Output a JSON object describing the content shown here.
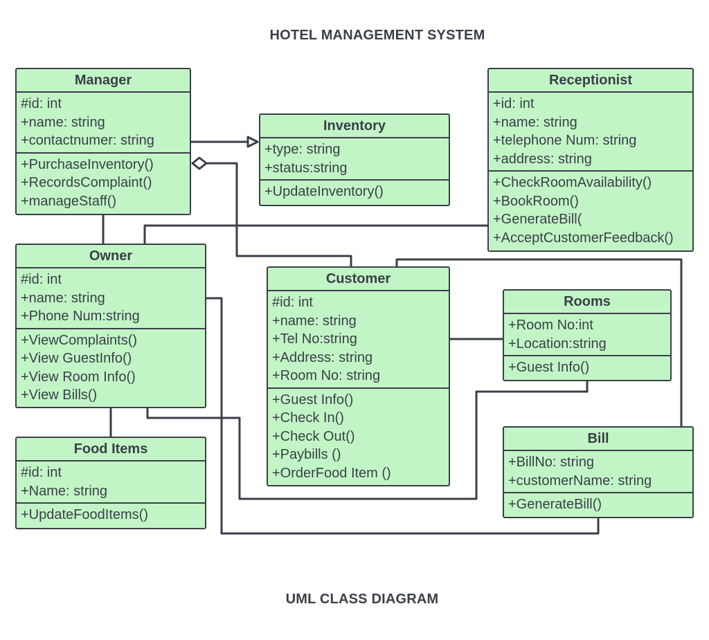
{
  "title": "HOTEL MANAGEMENT SYSTEM",
  "subtitle": "UML CLASS DIAGRAM",
  "colors": {
    "class_fill": "#c2f5c6",
    "stroke": "#3a3f47",
    "text": "#3a3f47"
  },
  "classes": {
    "manager": {
      "name": "Manager",
      "attributes": [
        "#id: int",
        "+name: string",
        "+contactnumer: string"
      ],
      "methods": [
        "+PurchaseInventory()",
        "+RecordsComplaint()",
        "+manageStaff()"
      ]
    },
    "inventory": {
      "name": "Inventory",
      "attributes": [
        "+type: string",
        "+status:string"
      ],
      "methods": [
        "+UpdateInventory()"
      ]
    },
    "receptionist": {
      "name": "Receptionist",
      "attributes": [
        "+id: int",
        "+name: string",
        "+telephone Num: string",
        "+address: string"
      ],
      "methods": [
        "+CheckRoomAvailability()",
        "+BookRoom()",
        "+GenerateBill(",
        "+AcceptCustomerFeedback()"
      ]
    },
    "owner": {
      "name": "Owner",
      "attributes": [
        "#id: int",
        "+name: string",
        "+Phone Num:string"
      ],
      "methods": [
        "+ViewComplaints()",
        "+View GuestInfo()",
        "+View Room Info()",
        "+View Bills()"
      ]
    },
    "customer": {
      "name": "Customer",
      "attributes": [
        "#id: int",
        "+name: string",
        "+Tel No:string",
        "+Address: string",
        "+Room No: string"
      ],
      "methods": [
        "+Guest Info()",
        "+Check In()",
        "+Check Out()",
        "+Paybills ()",
        "+OrderFood Item ()"
      ]
    },
    "rooms": {
      "name": "Rooms",
      "attributes": [
        "+Room No:int",
        "+Location:string"
      ],
      "methods": [
        "+Guest Info()"
      ]
    },
    "food_items": {
      "name": "Food Items",
      "attributes": [
        "#id: int",
        "+Name: string"
      ],
      "methods": [
        "+UpdateFoodItems()"
      ]
    },
    "bill": {
      "name": "Bill",
      "attributes": [
        "+BillNo: string",
        "+customerName: string"
      ],
      "methods": [
        "+GenerateBill()"
      ]
    }
  },
  "relationships": [
    {
      "from": "Manager",
      "to": "Inventory",
      "type": "generalization"
    },
    {
      "from": "Manager",
      "to": "Customer",
      "type": "aggregation"
    },
    {
      "from": "Manager",
      "to": "Owner",
      "type": "association"
    },
    {
      "from": "Owner",
      "to": "Receptionist",
      "type": "association"
    },
    {
      "from": "Owner",
      "to": "Food Items",
      "type": "association"
    },
    {
      "from": "Owner",
      "to": "Rooms",
      "type": "association"
    },
    {
      "from": "Owner",
      "to": "Bill",
      "type": "association"
    },
    {
      "from": "Customer",
      "to": "Rooms",
      "type": "association"
    },
    {
      "from": "Customer",
      "to": "Bill",
      "type": "association"
    }
  ]
}
